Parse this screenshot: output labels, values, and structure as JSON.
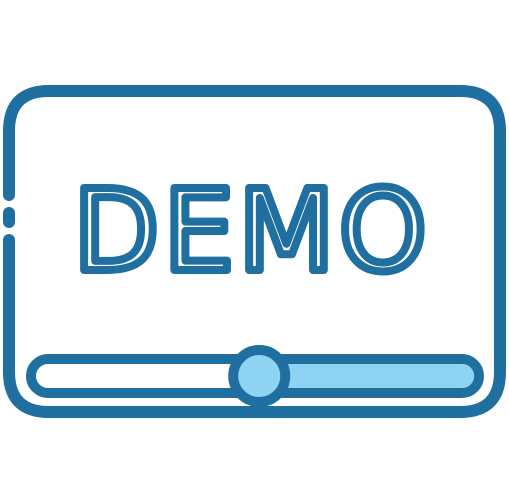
{
  "icon": {
    "label": "DEMO",
    "name": "demo-video-player-icon"
  },
  "slider": {
    "progress": 0.51
  },
  "colors": {
    "stroke": "#1f6fa0",
    "fill_light": "#8fd3f2",
    "background": "#ffffff"
  }
}
